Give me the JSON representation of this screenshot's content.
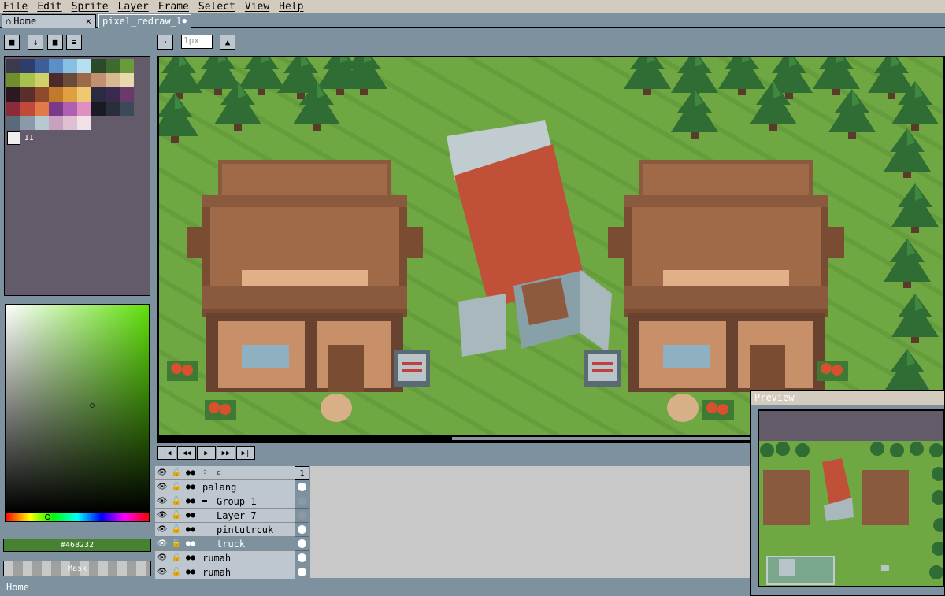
{
  "menu": [
    "File",
    "Edit",
    "Sprite",
    "Layer",
    "Frame",
    "Select",
    "View",
    "Help"
  ],
  "tabs": {
    "home": "Home",
    "home_close": "×",
    "file": "pixel_redraw_l",
    "file_dot": "●"
  },
  "toolbar": {
    "px_placeholder": "1px"
  },
  "color": {
    "hex": "#468232",
    "mask": "Mask"
  },
  "palette": [
    "#3a3a4a",
    "#2e3e6a",
    "#3d5e98",
    "#5a8fc8",
    "#87c0e2",
    "#b6e0f0",
    "#2a4a2a",
    "#3d6b2d",
    "#6a9a3a",
    "#6f8f2e",
    "#a7c24a",
    "#d0d06a",
    "#4a2a2a",
    "#6a4a3a",
    "#9a6a4a",
    "#c09070",
    "#d8b890",
    "#e8d8b0",
    "#2a1a20",
    "#5a2e2a",
    "#8e4a2a",
    "#c07a2a",
    "#e0a040",
    "#f0c870",
    "#2a2a40",
    "#3a2a50",
    "#6a3a6a",
    "#8a2a3a",
    "#c04a3a",
    "#e07a4a",
    "#7a3a8a",
    "#b060b0",
    "#e090c0",
    "#1a1a24",
    "#2a2e3a",
    "#3a4a5a",
    "#5a6a7a",
    "#8a9aa8",
    "#b8c8d0",
    "#c8a0c0",
    "#e0c0d0",
    "#f0e0e8"
  ],
  "layers": [
    {
      "name": "palang",
      "frame": "filled"
    },
    {
      "name": "Group 1",
      "frame": "empty",
      "group": true
    },
    {
      "name": "Layer 7",
      "frame": "empty",
      "indent": true
    },
    {
      "name": "pintutrcuk",
      "frame": "filled",
      "indent": true
    },
    {
      "name": "truck",
      "frame": "filled",
      "indent": true,
      "selected": true
    },
    {
      "name": "rumah",
      "frame": "filled"
    },
    {
      "name": "rumah",
      "frame": "filled"
    }
  ],
  "frame_number": "1",
  "status": "Home",
  "preview": {
    "title": "Preview"
  }
}
